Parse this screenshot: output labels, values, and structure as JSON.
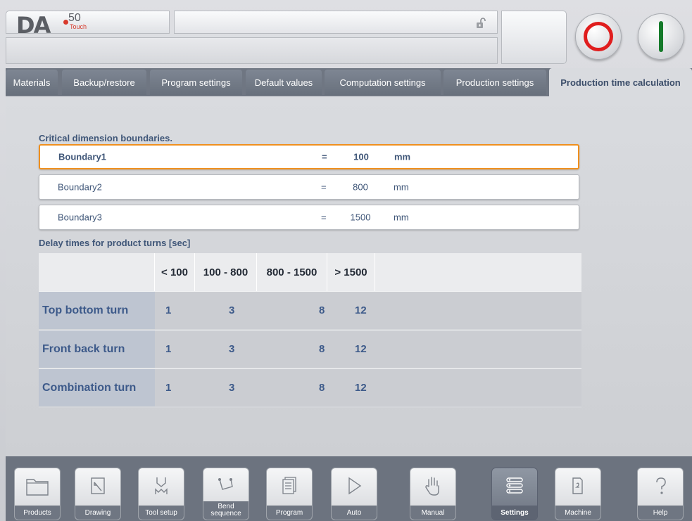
{
  "header": {
    "logo_brand": "DA",
    "logo_model": "50",
    "logo_sub": "Touch"
  },
  "tabs": [
    {
      "label": "Materials"
    },
    {
      "label": "Backup/restore"
    },
    {
      "label": "Program settings"
    },
    {
      "label": "Default values"
    },
    {
      "label": "Computation settings"
    },
    {
      "label": "Production settings"
    },
    {
      "label": "Production time calculation",
      "active": true
    }
  ],
  "critical": {
    "title": "Critical dimension boundaries.",
    "rows": [
      {
        "name": "Boundary1",
        "eq": "=",
        "value": "100",
        "unit": "mm"
      },
      {
        "name": "Boundary2",
        "eq": "=",
        "value": "800",
        "unit": "mm"
      },
      {
        "name": "Boundary3",
        "eq": "=",
        "value": "1500",
        "unit": "mm"
      }
    ]
  },
  "delay": {
    "title": "Delay times for product turns [sec]",
    "columns": [
      "< 100",
      "100 - 800",
      "800 - 1500",
      "> 1500"
    ],
    "rows": [
      {
        "label": "Top bottom turn",
        "values": [
          "1",
          "3",
          "8",
          "12"
        ]
      },
      {
        "label": "Front back turn",
        "values": [
          "1",
          "3",
          "8",
          "12"
        ]
      },
      {
        "label": "Combination turn",
        "values": [
          "1",
          "3",
          "8",
          "12"
        ]
      }
    ]
  },
  "nav": [
    {
      "label": "Products",
      "icon": "folder-icon"
    },
    {
      "label": "Drawing",
      "icon": "drawing-icon"
    },
    {
      "label": "Tool setup",
      "icon": "tool-setup-icon"
    },
    {
      "label": "Bend sequence",
      "icon": "bend-sequence-icon"
    },
    {
      "label": "Program",
      "icon": "program-icon"
    },
    {
      "label": "Auto",
      "icon": "play-icon"
    },
    {
      "label": "Manual",
      "icon": "hand-icon"
    },
    {
      "label": "Settings",
      "icon": "settings-list-icon",
      "active": true
    },
    {
      "label": "Machine",
      "icon": "machine-icon"
    },
    {
      "label": "Help",
      "icon": "help-icon"
    }
  ],
  "colors": {
    "accent": "#f0901e",
    "stop": "#e01e1e",
    "start": "#157a2a",
    "text_blue": "#3d5a8a"
  }
}
